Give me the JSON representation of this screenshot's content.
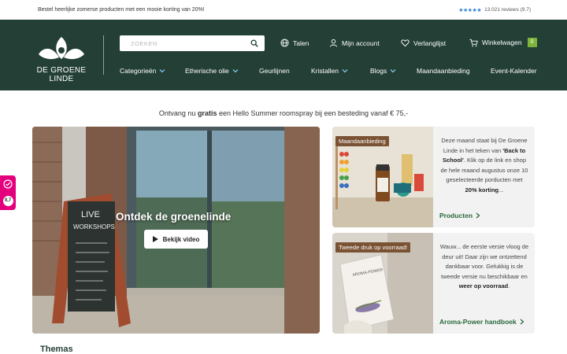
{
  "topbar": {
    "promo": "Bestel heerlijke zomerse producten met een mooie korting van 20%!",
    "reviews": "13.021 reviews (9.7)",
    "stars": "★★★★★"
  },
  "header": {
    "logo_text": "DE GROENE LINDE",
    "search_placeholder": "ZOEKEN",
    "utils": {
      "languages": "Talen",
      "account": "Mijn account",
      "wishlist": "Verlanglijst",
      "cart": "Winkelwagen",
      "cart_count": "0"
    },
    "nav": [
      {
        "label": "Categorieën",
        "dropdown": true
      },
      {
        "label": "Etherische olie",
        "dropdown": true
      },
      {
        "label": "Geurlijnen",
        "dropdown": false
      },
      {
        "label": "Kristallen",
        "dropdown": true
      },
      {
        "label": "Blogs",
        "dropdown": true
      },
      {
        "label": "Maandaanbieding",
        "dropdown": false
      },
      {
        "label": "Event-Kalender",
        "dropdown": false
      }
    ]
  },
  "promo_banner": {
    "before": "Ontvang nu ",
    "bold": "gratis",
    "after": " een Hello Summer roomspray bij een besteding vanaf € 75,-"
  },
  "hero": {
    "title": "Ontdek de groenelinde",
    "button": "Bekijk video",
    "sign_lines": [
      "LIVE",
      "WORKSHOPS"
    ]
  },
  "cards": [
    {
      "badge": "Maandaanbieding",
      "text_1": "Deze maand staat bij De Groene Linde in het teken van ",
      "bold_1": "'Back to School'",
      "text_2": ". Klik op de link en shop de hele maand augustus onze 10 geselecteerde porducten met ",
      "bold_2": "20% korting",
      "text_3": "...",
      "link": "Producten"
    },
    {
      "badge": "Tweede druk op voorraad!",
      "text_1": "Wauw... de eerste versie vloog de deur uit! Daar zijn we ontzettend dankbaar voor. Gelukkig is de tweede versie nu beschikbaar en ",
      "bold_1": "weer op voorraad",
      "text_2": ".",
      "link": "Aroma-Power handboek"
    }
  ],
  "float_badge": {
    "score": "9,7"
  },
  "sections": {
    "themas": "Themas"
  },
  "colors": {
    "header_bg": "#233f36",
    "accent_green": "#7fb43a",
    "link_green": "#2a6a3c",
    "badge_brown": "#7a5334",
    "review_pink": "#e4007c"
  }
}
